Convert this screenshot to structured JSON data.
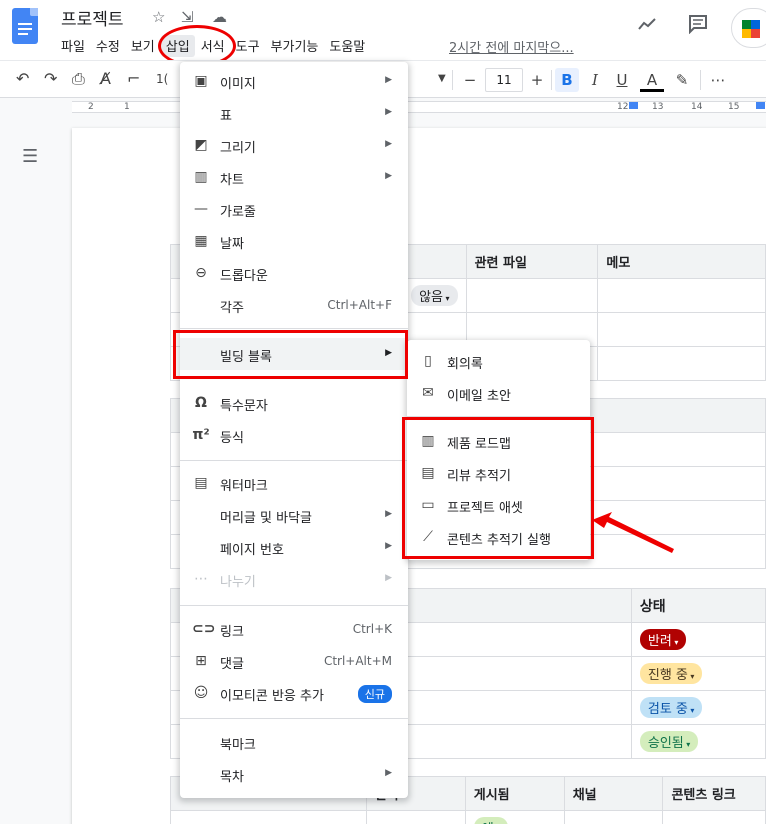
{
  "header": {
    "title": "프로젝트",
    "menus": [
      "파일",
      "수정",
      "보기",
      "삽입",
      "서식",
      "도구",
      "부가기능",
      "도움말"
    ],
    "active_menu": "삽입",
    "last_edit": "2시간 전에 마지막으..."
  },
  "toolbar": {
    "zoom_partial": "1(",
    "font_size": "11",
    "minus": "−",
    "plus": "+",
    "bold": "B",
    "italic": "I",
    "underline": "U",
    "text_color": "A",
    "more": "⋯"
  },
  "ruler": {
    "numbers": [
      "2",
      "1",
      "12",
      "13",
      "14",
      "15"
    ]
  },
  "insert_menu": {
    "items": [
      {
        "icon": "image-icon",
        "label": "이미지",
        "submenu": true
      },
      {
        "icon": "table-icon",
        "label": "표",
        "submenu": true
      },
      {
        "icon": "drawing-icon",
        "label": "그리기",
        "submenu": true
      },
      {
        "icon": "chart-icon",
        "label": "차트",
        "submenu": true
      },
      {
        "icon": "horizontal-line-icon",
        "label": "가로줄"
      },
      {
        "icon": "date-icon",
        "label": "날짜"
      },
      {
        "icon": "dropdown-icon",
        "label": "드롭다운"
      },
      {
        "icon": "",
        "label": "각주",
        "shortcut": "Ctrl+Alt+F"
      },
      {
        "icon": "",
        "label": "빌딩 블록",
        "submenu": true
      },
      {
        "icon": "omega-icon",
        "label": "특수문자"
      },
      {
        "icon": "equation-icon",
        "label": "등식"
      },
      {
        "icon": "watermark-icon",
        "label": "워터마크"
      },
      {
        "icon": "",
        "label": "머리글 및 바닥글",
        "submenu": true
      },
      {
        "icon": "",
        "label": "페이지 번호",
        "submenu": true
      },
      {
        "icon": "break-icon",
        "label": "나누기",
        "submenu": true
      },
      {
        "icon": "link-icon",
        "label": "링크",
        "shortcut": "Ctrl+K"
      },
      {
        "icon": "comment-icon",
        "label": "댓글",
        "shortcut": "Ctrl+Alt+M"
      },
      {
        "icon": "emoji-icon",
        "label": "이모티콘 반응 추가",
        "badge": "신규"
      },
      {
        "icon": "",
        "label": "북마크"
      },
      {
        "icon": "",
        "label": "목차",
        "submenu": true
      }
    ]
  },
  "building_blocks_menu": {
    "items": [
      {
        "icon": "document-icon",
        "label": "회의록"
      },
      {
        "icon": "email-icon",
        "label": "이메일 초안"
      },
      {
        "icon": "map-icon",
        "label": "제품 로드맵"
      },
      {
        "icon": "clipboard-icon",
        "label": "리뷰 추적기"
      },
      {
        "icon": "archive-icon",
        "label": "프로젝트 애셋"
      },
      {
        "icon": "trend-icon",
        "label": "콘텐츠 추적기 실행"
      }
    ]
  },
  "doc": {
    "table1": {
      "headers": [
        "관련 파일",
        "메모"
      ],
      "chip": "않음"
    },
    "table3": {
      "header": "상태",
      "statuses": [
        {
          "label": "반려",
          "bg": "#b10202",
          "fg": "#ffffff"
        },
        {
          "label": "진행 중",
          "bg": "#ffe5a0",
          "fg": "#473821"
        },
        {
          "label": "검토 중",
          "bg": "#bfe1f6",
          "fg": "#0a53a8"
        },
        {
          "label": "승인됨",
          "bg": "#d4edbc",
          "fg": "#11734b"
        }
      ]
    },
    "table4": {
      "headers": [
        "날짜",
        "게시됨",
        "채널",
        "콘텐츠 링크"
      ],
      "chip": "예"
    }
  },
  "colors": {
    "accent": "#1a73e8",
    "annotation": "#ee0000"
  }
}
